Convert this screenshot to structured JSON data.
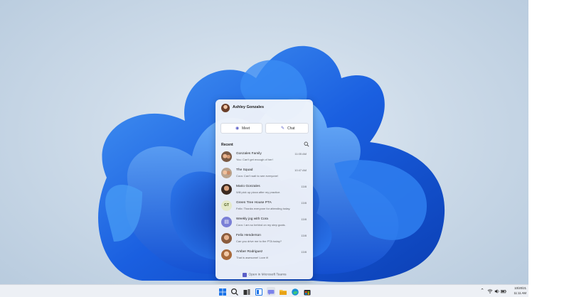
{
  "flyout": {
    "user_name": "Ashley Gonzales",
    "meet_label": "Meet",
    "chat_label": "Chat",
    "recent_label": "Recent",
    "open_teams_label": "Open in Microsoft Teams",
    "conversations": [
      {
        "name": "Gonzales Family",
        "preview": "You: Can't get enough of her!",
        "time": "11:05 AM",
        "avatar": "group-photo"
      },
      {
        "name": "The Squad",
        "preview": "Cora: Can't wait to see everyone!",
        "time": "10:47 AM",
        "avatar": "group-photo"
      },
      {
        "name": "Mario Gonzales",
        "preview": "Will pick up pizza after my practice.",
        "time": "13/8",
        "avatar": "person-photo"
      },
      {
        "name": "Green Tree House PTA",
        "preview": "Felix: Thanks everyone for attending today.",
        "time": "13/8",
        "avatar": "GT"
      },
      {
        "name": "Weekly jog with Cora",
        "preview": "Cora: I am so behind on my step goals.",
        "time": "13/8",
        "avatar": "calendar-icon"
      },
      {
        "name": "Felix Henderson",
        "preview": "Can you drive me to the PTA today?",
        "time": "13/8",
        "avatar": "person-photo"
      },
      {
        "name": "Amber Rodriguez",
        "preview": "That is awesome! Love it!",
        "time": "13/8",
        "avatar": "person-photo"
      }
    ]
  },
  "taskbar": {
    "icons": [
      "windows-start-icon",
      "search-icon",
      "task-view-icon",
      "widgets-icon",
      "chat-icon",
      "file-explorer-icon",
      "edge-icon",
      "store-icon"
    ],
    "tray": [
      "chevron-up-icon",
      "wifi-icon",
      "volume-icon",
      "battery-icon"
    ],
    "date": "10/20/21",
    "time": "11:11 AM"
  },
  "colors": {
    "accent": "#5b5fc7",
    "bloom": "#1a5fe0"
  }
}
